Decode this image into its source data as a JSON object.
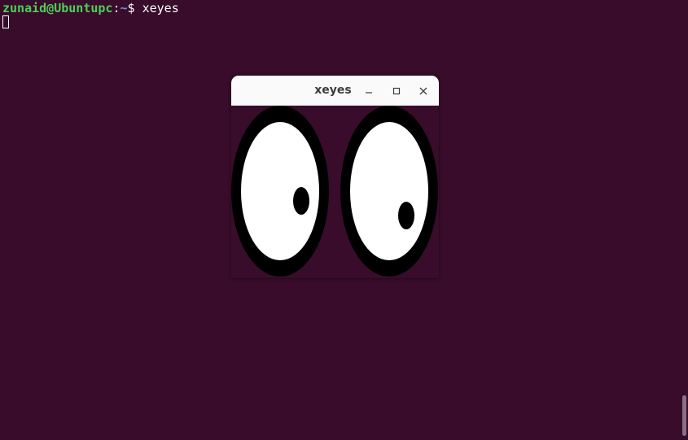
{
  "terminal": {
    "prompt_user": "zunaid@Ubuntupc",
    "prompt_sep": ":",
    "prompt_path": "~",
    "prompt_dollar": "$ ",
    "command": "xeyes",
    "background": "#380c2a"
  },
  "xeyes": {
    "title": "xeyes",
    "minimize_icon": "minimize-icon",
    "maximize_icon": "maximize-icon",
    "close_icon": "close-icon"
  }
}
